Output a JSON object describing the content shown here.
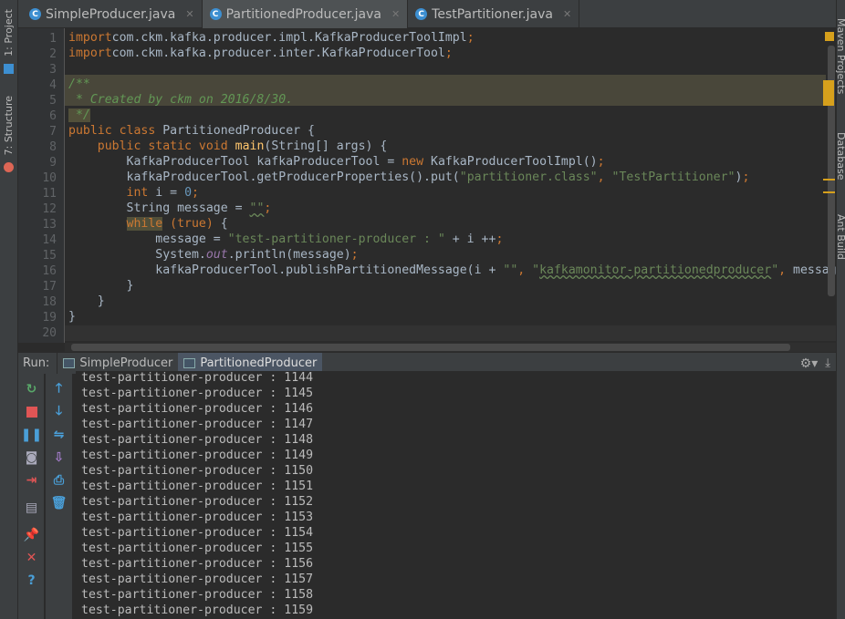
{
  "left_strip": {
    "project": "1: Project",
    "structure": "7: Structure"
  },
  "right_strip": {
    "maven": "Maven Projects",
    "database": "Database",
    "ant": "Ant Build"
  },
  "tabs": [
    {
      "label": "SimpleProducer.java",
      "active": false
    },
    {
      "label": "PartitionedProducer.java",
      "active": true
    },
    {
      "label": "TestPartitioner.java",
      "active": false
    }
  ],
  "code_lines": [
    [
      [
        "kw",
        "import"
      ],
      [
        "",
        "com.ckm.kafka.producer.impl.KafkaProducerToolImpl"
      ],
      [
        "kw",
        ";"
      ]
    ],
    [
      [
        "kw",
        "import"
      ],
      [
        "",
        "com.ckm.kafka.producer.inter.KafkaProducerTool"
      ],
      [
        "kw",
        ";"
      ]
    ],
    [],
    [
      [
        "cm",
        "/**"
      ]
    ],
    [
      [
        "cm",
        " * Created by ckm on 2016/8/30."
      ]
    ],
    [
      [
        "cm hl",
        " */"
      ]
    ],
    [
      [
        "kw",
        "public class "
      ],
      [
        "",
        "PartitionedProducer {"
      ]
    ],
    [
      [
        "",
        "    "
      ],
      [
        "kw",
        "public static void "
      ],
      [
        "fn",
        "main"
      ],
      [
        "",
        "(String[] args) {"
      ]
    ],
    [
      [
        "",
        "        KafkaProducerTool kafkaProducerTool = "
      ],
      [
        "kw",
        "new "
      ],
      [
        "",
        "KafkaProducerToolImpl()"
      ],
      [
        "kw",
        ";"
      ]
    ],
    [
      [
        "",
        "        kafkaProducerTool.getProducerProperties().put("
      ],
      [
        "str",
        "\"partitioner.class\""
      ],
      [
        "kw",
        ", "
      ],
      [
        "str",
        "\"TestPartitioner\""
      ],
      [
        "",
        ")"
      ],
      [
        "kw",
        ";"
      ]
    ],
    [
      [
        "",
        "        "
      ],
      [
        "kw",
        "int "
      ],
      [
        "",
        "i = "
      ],
      [
        "num",
        "0"
      ],
      [
        "kw",
        ";"
      ]
    ],
    [
      [
        "",
        "        String message = "
      ],
      [
        "str sq",
        "\"\""
      ],
      [
        "kw",
        ";"
      ]
    ],
    [
      [
        "",
        "        "
      ],
      [
        "kw hl",
        "while"
      ],
      [
        "",
        ""
      ],
      [
        "kw",
        " (true) "
      ],
      [
        "",
        "{"
      ]
    ],
    [
      [
        "",
        "            message = "
      ],
      [
        "str",
        "\"test-partitioner-producer : \""
      ],
      [
        "",
        " + i ++"
      ],
      [
        "kw",
        ";"
      ]
    ],
    [
      [
        "",
        "            System."
      ],
      [
        "st",
        "out"
      ],
      [
        "",
        ".println(message)"
      ],
      [
        "kw",
        ";"
      ]
    ],
    [
      [
        "",
        "            kafkaProducerTool.publishPartitionedMessage(i + "
      ],
      [
        "str",
        "\"\""
      ],
      [
        "kw",
        ", "
      ],
      [
        "str",
        "\""
      ],
      [
        "str sq",
        "kafkamonitor-partitionedproducer"
      ],
      [
        "str",
        "\""
      ],
      [
        "kw",
        ", "
      ],
      [
        "",
        "message"
      ]
    ],
    [
      [
        "",
        "        }"
      ]
    ],
    [
      [
        "",
        "    }"
      ]
    ],
    [
      [
        "",
        "}"
      ]
    ],
    []
  ],
  "run": {
    "label": "Run:",
    "tabs": [
      {
        "label": "SimpleProducer",
        "active": false
      },
      {
        "label": "PartitionedProducer",
        "active": true
      }
    ]
  },
  "console_lines": [
    "test-partitioner-producer : 1144",
    "test-partitioner-producer : 1145",
    "test-partitioner-producer : 1146",
    "test-partitioner-producer : 1147",
    "test-partitioner-producer : 1148",
    "test-partitioner-producer : 1149",
    "test-partitioner-producer : 1150",
    "test-partitioner-producer : 1151",
    "test-partitioner-producer : 1152",
    "test-partitioner-producer : 1153",
    "test-partitioner-producer : 1154",
    "test-partitioner-producer : 1155",
    "test-partitioner-producer : 1156",
    "test-partitioner-producer : 1157",
    "test-partitioner-producer : 1158",
    "test-partitioner-producer : 1159"
  ],
  "colors": {
    "keyword": "#cc7832",
    "string": "#6a8759",
    "comment": "#629755",
    "number": "#6897bb",
    "text": "#a9b7c6",
    "background": "#2b2b2b"
  }
}
